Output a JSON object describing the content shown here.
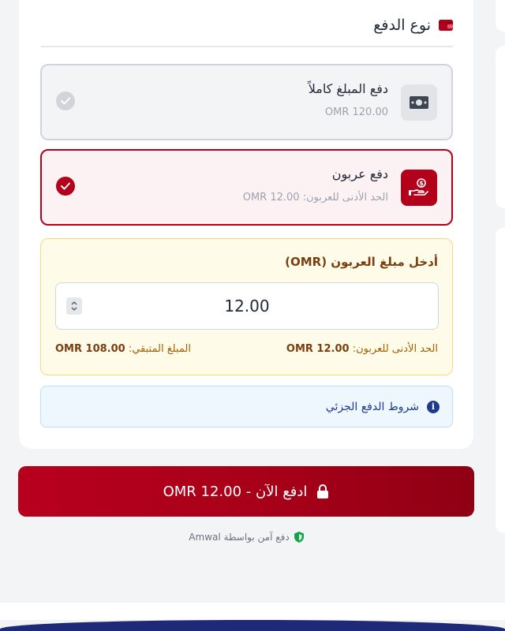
{
  "payment_type": {
    "title": "نوع الدفع",
    "icon": "wallet-icon"
  },
  "options": {
    "full": {
      "title": "دفع المبلغ كاملاً",
      "amount": "OMR 120.00",
      "icon": "cash-icon",
      "selected": false
    },
    "deposit": {
      "title": "دفع عربون",
      "min_text": "الحد الأدنى للعربون: OMR 12.00",
      "icon": "hand-coin-icon",
      "selected": true
    }
  },
  "deposit_form": {
    "label": "أدخل مبلغ العربون (OMR)",
    "value": "12.00",
    "min_label": "الحد الأدنى للعربون:",
    "min_value": "OMR 12.00",
    "remaining_label": "المبلغ المتبقي:",
    "remaining_value": "OMR 108.00"
  },
  "terms": {
    "label": "شروط الدفع الجزئي",
    "icon": "info-icon"
  },
  "pay_button": {
    "label": "ادفع الآن - OMR 12.00",
    "icon": "lock-icon"
  },
  "secure_note": {
    "text": "دفع آمن بواسطة Amwal",
    "icon": "shield-icon"
  },
  "colors": {
    "primary": "#b3001b",
    "deposit_bg": "#fefbe8",
    "terms_bg": "#eef7fd",
    "footer": "#1e2a78"
  }
}
